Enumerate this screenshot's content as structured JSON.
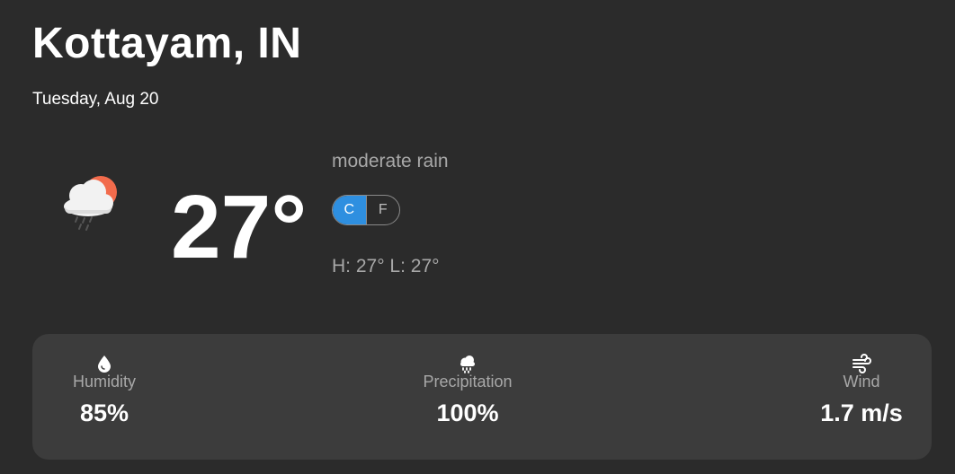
{
  "location": {
    "city": "Kottayam, IN",
    "date": "Tuesday, Aug 20"
  },
  "current": {
    "icon": "rain-cloud-sun-icon",
    "temperature": "27°",
    "condition": "moderate rain",
    "high_low": "H: 27° L: 27°"
  },
  "units": {
    "celsius_label": "C",
    "fahrenheit_label": "F",
    "selected": "C"
  },
  "stats": {
    "humidity": {
      "label": "Humidity",
      "value": "85%",
      "icon": "water-drop-icon"
    },
    "precipitation": {
      "label": "Precipitation",
      "value": "100%",
      "icon": "rain-cloud-icon"
    },
    "wind": {
      "label": "Wind",
      "value": "1.7 m/s",
      "icon": "wind-icon"
    }
  },
  "colors": {
    "background": "#2b2b2b",
    "card": "#3c3c3c",
    "accent": "#2e8fe0",
    "muted_text": "#a8a8a8",
    "sun": "#f26b4c"
  }
}
